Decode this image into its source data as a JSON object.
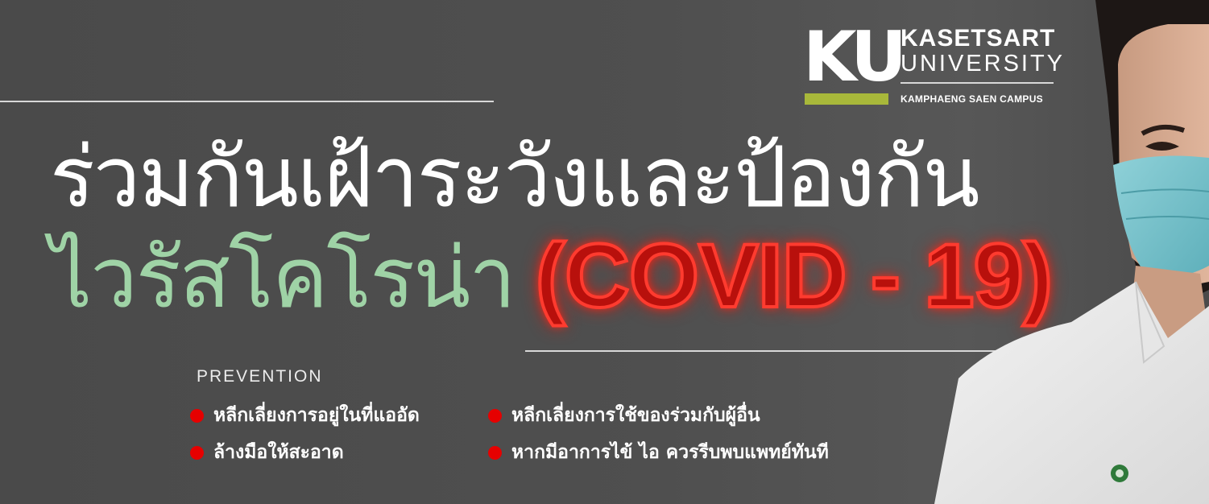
{
  "logo": {
    "mark": "KU",
    "name_line1": "KASETSART",
    "name_line2": "UNIVERSITY",
    "campus": "KAMPHAENG SAEN CAMPUS"
  },
  "headline": {
    "line1": "ร่วมกันเฝ้าระวังและป้องกัน",
    "line2_thai": "ไวรัสโคโรน่า",
    "line2_covid": "(COVID - 19)"
  },
  "prevention": {
    "title": "PREVENTION",
    "tips": [
      "หลีกเลี่ยงการอยู่ในที่แออัด",
      "หลีกเลี่ยงการใช้ของร่วมกับผู้อื่น",
      "ล้างมือให้สะอาด",
      "หากมีอาการไข้ ไอ ควรรีบพบแพทย์ทันที"
    ]
  },
  "colors": {
    "background": "#4f4f4f",
    "headline_white": "#ffffff",
    "headline_green": "#9fd3a6",
    "covid_red": "#b8100c",
    "bullet_red": "#e60000",
    "logo_bar": "#a8b83a"
  }
}
